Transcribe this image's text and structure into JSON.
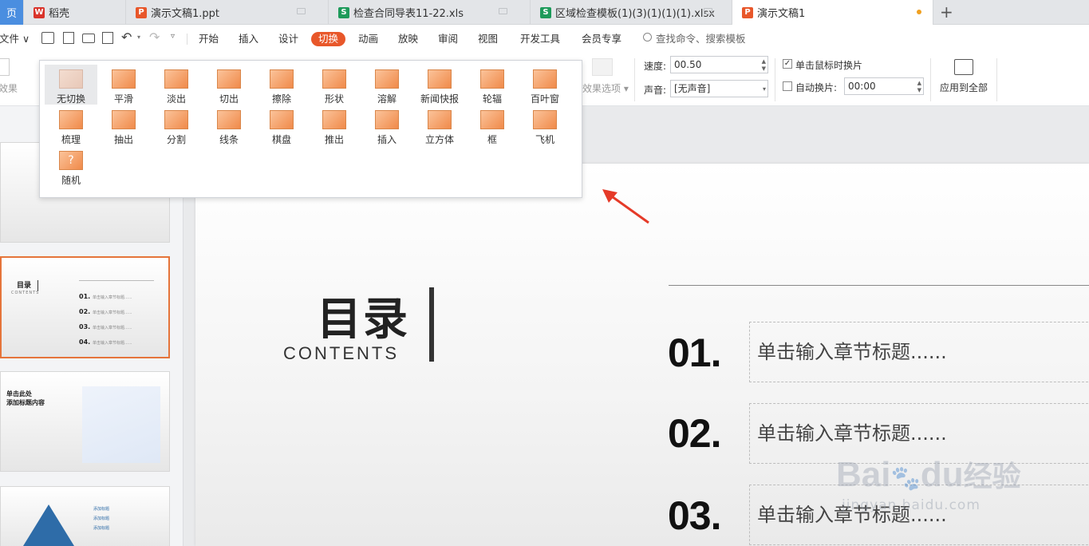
{
  "tabs": [
    {
      "label": "页",
      "type": "home"
    },
    {
      "label": "稻壳",
      "type": "docer"
    },
    {
      "label": "演示文稿1.ppt",
      "type": "ppt"
    },
    {
      "label": "检查合同导表11-22.xls",
      "type": "xls"
    },
    {
      "label": "区域检查模板(1)(3)(1)(1)(1).xlsx",
      "type": "xls"
    },
    {
      "label": "演示文稿1",
      "type": "ppt"
    }
  ],
  "new_tab": "+",
  "menu": {
    "file": "文件",
    "items": [
      "开始",
      "插入",
      "设计",
      "切换",
      "动画",
      "放映",
      "审阅",
      "视图",
      "开发工具",
      "会员专享"
    ],
    "active": "切换",
    "search_placeholder": "查找命令、搜索模板"
  },
  "ribbon": {
    "effect_label": "效果",
    "effect_options": "效果选项",
    "speed_label": "速度:",
    "speed_value": "00.50",
    "sound_label": "声音:",
    "sound_value": "[无声音]",
    "click_label": "单击鼠标时换片",
    "click_checked": true,
    "auto_label": "自动换片:",
    "auto_checked": false,
    "auto_value": "00:00",
    "apply_all": "应用到全部"
  },
  "gallery": {
    "items": [
      "无切换",
      "平滑",
      "淡出",
      "切出",
      "擦除",
      "形状",
      "溶解",
      "新闻快报",
      "轮辐",
      "百叶窗",
      "梳理",
      "抽出",
      "分割",
      "线条",
      "棋盘",
      "推出",
      "插入",
      "立方体",
      "框",
      "飞机",
      "随机"
    ],
    "selected": "无切换"
  },
  "thumbs": {
    "s2_title": "目录",
    "s2_sub": "CONTENTS",
    "s2_items": [
      "01.",
      "02.",
      "03.",
      "04."
    ],
    "s2_item_text": "单击输入章节标题......",
    "s3_title_line1": "单击此处",
    "s3_title_line2": "添加标题内容",
    "s4_items": [
      "添加标题",
      "添加标题",
      "添加标题"
    ]
  },
  "slide": {
    "title": "目录",
    "subtitle": "CONTENTS",
    "items": [
      {
        "num": "01.",
        "text": "单击输入章节标题......"
      },
      {
        "num": "02.",
        "text": "单击输入章节标题......"
      },
      {
        "num": "03.",
        "text": "单击输入章节标题......"
      }
    ]
  },
  "watermark": {
    "brand": "Bai",
    "suffix": "du",
    "cn": "经验",
    "url": "jingyan.baidu.com"
  },
  "colors": {
    "accent": "#e8572a",
    "ppt": "#e8572a",
    "xls": "#1d9a5a",
    "docer": "#d9342b"
  }
}
